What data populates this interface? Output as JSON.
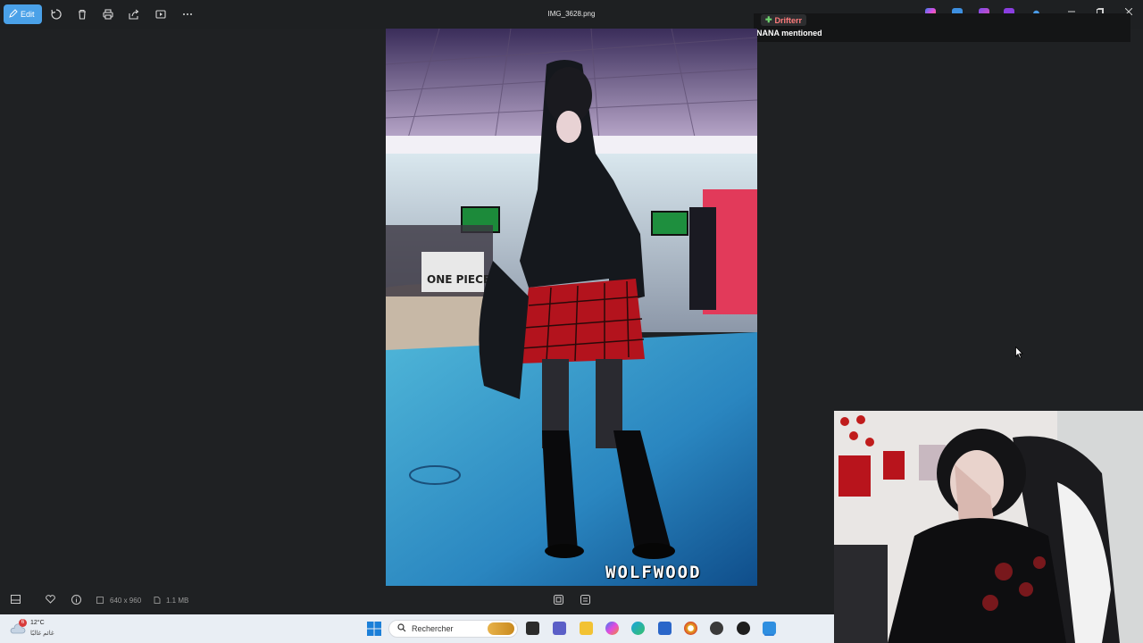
{
  "toolbar": {
    "edit_label": "Edit",
    "file_name": "IMG_3628.png"
  },
  "notification": {
    "badge": "Drifterr",
    "message": "NANA mentioned"
  },
  "photo": {
    "watermark": "WOLFWOOD",
    "shirt_text": "ONE PIECE"
  },
  "infobar": {
    "dimensions": "640 x 960",
    "file_size": "1.1 MB"
  },
  "taskbar": {
    "weather_temp": "12°C",
    "weather_desc": "غائم غالبًا",
    "weather_badge": "6",
    "search_placeholder": "Rechercher"
  },
  "colors": {
    "accent": "#4aa1e8",
    "app_background": "#1f2123",
    "taskbar_background": "#e9eef4"
  }
}
